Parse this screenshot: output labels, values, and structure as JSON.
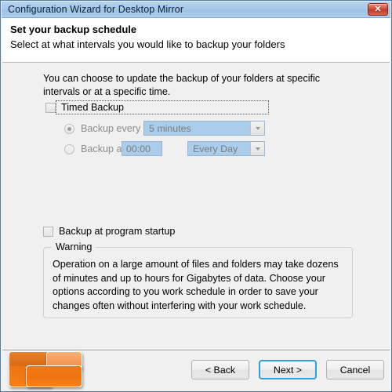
{
  "window": {
    "title": "Configuration Wizard for Desktop Mirror",
    "close_icon": "close-icon",
    "close_glyph": "✕",
    "accent_title_color": "#a6c8e9",
    "accent_focus_color": "#2ba2dc",
    "accent_logo_color": "#ef7410"
  },
  "header": {
    "title": "Set your backup schedule",
    "subtitle": "Select at what intervals you would like to backup your folders"
  },
  "main": {
    "intro": "You can choose to update the backup of your folders at specific intervals or at a specific time.",
    "timed_backup": {
      "label": "Timed Backup",
      "checked": false,
      "focused": true
    },
    "backup_every": {
      "label": "Backup every",
      "selected": true,
      "combo_value": "5 minutes",
      "combo_icon": "chevron-down-icon"
    },
    "backup_at": {
      "label": "Backup at",
      "selected": false,
      "time_value": "00:00",
      "combo_value": "Every Day",
      "combo_icon": "chevron-down-icon"
    },
    "startup_backup": {
      "label": "Backup at program startup",
      "checked": false
    },
    "warning": {
      "legend": "Warning",
      "text": "Operation on a large amount of files and folders may take dozens of minutes and up to hours for Gigabytes of data. Choose your options according to you work schedule in order to save your changes often without interfering with your work schedule."
    }
  },
  "footer": {
    "logo_icon": "app-logo-icon",
    "back_label": "< Back",
    "next_label": "Next >",
    "cancel_label": "Cancel"
  }
}
